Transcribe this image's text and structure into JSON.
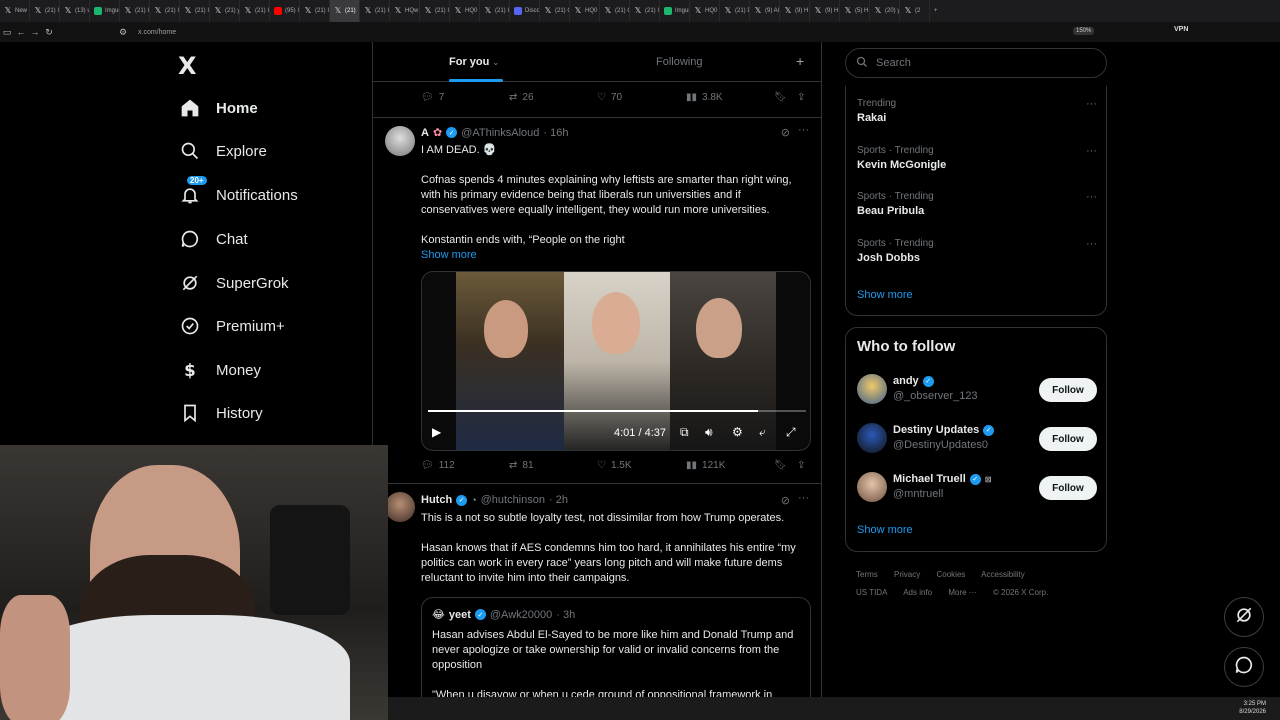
{
  "browser": {
    "tabs": [
      {
        "label": "New",
        "icon": "x-icon"
      },
      {
        "label": "(21) I",
        "icon": "x-icon"
      },
      {
        "label": "(13) u",
        "icon": "x-icon"
      },
      {
        "label": "Imgur",
        "icon": "imgur-icon"
      },
      {
        "label": "(21) I",
        "icon": "x-icon"
      },
      {
        "label": "(21) I",
        "icon": "x-icon"
      },
      {
        "label": "(21) I",
        "icon": "x-icon"
      },
      {
        "label": "(21) y",
        "icon": "x-icon"
      },
      {
        "label": "(21) I",
        "icon": "x-icon"
      },
      {
        "label": "(95) I",
        "icon": "youtube-icon"
      },
      {
        "label": "(21) I",
        "icon": "x-icon"
      },
      {
        "label": "(21)",
        "icon": "x-icon",
        "active": true
      },
      {
        "label": "(21) I",
        "icon": "x-icon"
      },
      {
        "label": "HQw",
        "icon": "x-icon"
      },
      {
        "label": "(21) I",
        "icon": "x-icon"
      },
      {
        "label": "HQ0",
        "icon": "x-icon"
      },
      {
        "label": "(21) I",
        "icon": "x-icon"
      },
      {
        "label": "Disco",
        "icon": "discord-icon"
      },
      {
        "label": "(21) C",
        "icon": "x-icon"
      },
      {
        "label": "HQ0",
        "icon": "x-icon"
      },
      {
        "label": "(21) C",
        "icon": "x-icon"
      },
      {
        "label": "(21) I",
        "icon": "x-icon"
      },
      {
        "label": "Imgur",
        "icon": "imgur-icon"
      },
      {
        "label": "HQ0",
        "icon": "x-icon"
      },
      {
        "label": "(21) D",
        "icon": "x-icon"
      },
      {
        "label": "(9) Al",
        "icon": "x-icon"
      },
      {
        "label": "(9) H",
        "icon": "x-icon"
      },
      {
        "label": "(9) H",
        "icon": "x-icon"
      },
      {
        "label": "(5) H",
        "icon": "x-icon"
      },
      {
        "label": "(20) y",
        "icon": "x-icon"
      },
      {
        "label": "(2",
        "icon": "x-icon"
      }
    ],
    "url": "x.com/home",
    "zoom": "150%",
    "vpn": "VPN"
  },
  "nav": {
    "logo": "X",
    "items": [
      {
        "label": "Home",
        "icon": "home-icon",
        "active": true
      },
      {
        "label": "Explore",
        "icon": "search-icon"
      },
      {
        "label": "Notifications",
        "icon": "bell-icon",
        "badge": "20+"
      },
      {
        "label": "Chat",
        "icon": "chat-icon"
      },
      {
        "label": "SuperGrok",
        "icon": "grok-icon"
      },
      {
        "label": "Premium+",
        "icon": "premium-icon"
      },
      {
        "label": "Money",
        "icon": "dollar-icon"
      },
      {
        "label": "History",
        "icon": "bookmark-icon"
      }
    ]
  },
  "feed": {
    "tabs": {
      "for_you": "For you",
      "following": "Following"
    },
    "prev_actions": {
      "replies": "7",
      "reposts": "26",
      "likes": "70",
      "views": "3.8K"
    },
    "tweet1": {
      "name": "A",
      "emoji": "✿",
      "handle": "@AThinksAloud",
      "time": "· 16h",
      "line1": "I AM DEAD. 💀",
      "para1": "Cofnas spends 4 minutes explaining why leftists are smarter than right wing, with his primary evidence being that liberals run universities and if conservatives were equally intelligent, they would run more universities.",
      "para2": "Konstantin ends with, “People on the right",
      "show_more": "Show more",
      "video": {
        "time": "4:01 / 4:37",
        "progress": 0.873
      },
      "actions": {
        "replies": "112",
        "reposts": "81",
        "likes": "1.5K",
        "views": "121K"
      }
    },
    "tweet2": {
      "name": "Hutch",
      "handle": "@hutchinson",
      "time": "· 2h",
      "para1": "This is a not so subtle loyalty test, not dissimilar from how Trump operates.",
      "para2": "Hasan knows that if AES condemns him too hard, it annihilates his entire “my politics can work in every race” years long pitch and will make future dems reluctant to invite him into their campaigns.",
      "quote": {
        "emoji": "😂",
        "name": "yeet",
        "handle": "@Awk20000",
        "time": "· 3h",
        "para1": "Hasan advises Abdul El-Sayed to be more like him and Donald Trump and never apologize or take ownership for valid or invalid concerns from the opposition",
        "para2": "\"When u disavow or when u cede ground of oppositional framework in"
      }
    }
  },
  "sidebar": {
    "search_placeholder": "Search",
    "trends": [
      {
        "category": "Trending",
        "name": "Rakai"
      },
      {
        "category": "Sports · Trending",
        "name": "Kevin McGonigle"
      },
      {
        "category": "Sports · Trending",
        "name": "Beau Pribula"
      },
      {
        "category": "Sports · Trending",
        "name": "Josh Dobbs"
      }
    ],
    "trends_show_more": "Show more",
    "who_to_follow": {
      "title": "Who to follow",
      "follow_label": "Follow",
      "accounts": [
        {
          "name": "andy",
          "handle": "@_observer_123"
        },
        {
          "name": "Destiny Updates",
          "handle": "@DestinyUpdates0"
        },
        {
          "name": "Michael Truell",
          "handle": "@mntruell"
        }
      ],
      "show_more": "Show more"
    },
    "footer": {
      "links": [
        "Terms",
        "Privacy",
        "Cookies",
        "Accessibility",
        "US TIDA",
        "Ads info",
        "More ···",
        "© 2026 X Corp."
      ]
    }
  },
  "taskbar": {
    "time": "3:25 PM",
    "date": "8/29/2026"
  }
}
